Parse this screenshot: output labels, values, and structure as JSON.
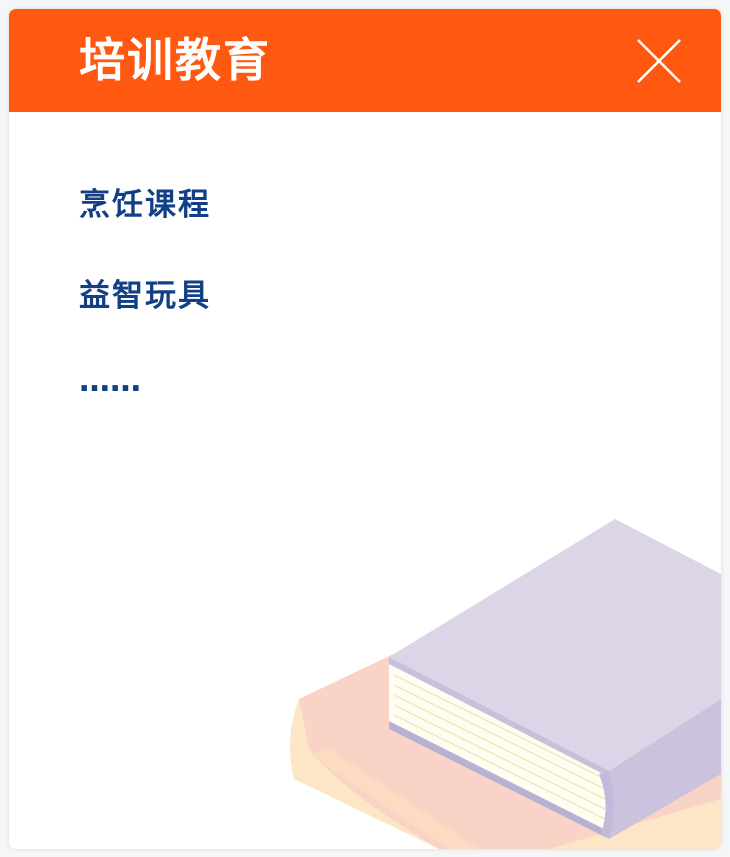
{
  "dialog": {
    "title": "培训教育",
    "close_icon": "close-icon",
    "items": [
      {
        "label": "烹饪课程"
      },
      {
        "label": "益智玩具"
      },
      {
        "label": "……"
      }
    ]
  },
  "colors": {
    "header": "#ff5811",
    "item_text": "#123f86",
    "book_top": "#dcd5e7",
    "book_side": "#c9c1dd",
    "book_pages": "#fffdf2",
    "book_bottom_pink": "#f8d1c5",
    "book_bottom_cream": "#fde6c6"
  },
  "illustration": "books-illustration"
}
